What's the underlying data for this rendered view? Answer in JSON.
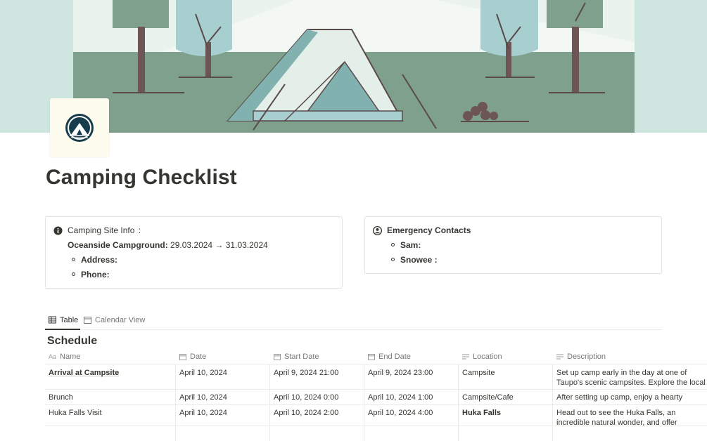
{
  "page": {
    "title": "Camping Checklist",
    "icon": "camping-tent-logo-icon",
    "cover": "tent-landscape-illustration"
  },
  "camping_site": {
    "heading": "Camping Site Info",
    "heading_suffix": ":",
    "icon": "info-icon",
    "site_name": "Oceanside Campground:",
    "dates": "29.03.2024 → 31.03.2024",
    "items": [
      {
        "label": "Address:"
      },
      {
        "label": "Phone:"
      }
    ]
  },
  "emergency": {
    "heading": "Emergency Contacts",
    "icon": "person-circle-icon",
    "items": [
      {
        "label": "Sam:"
      },
      {
        "label": "Snowee :"
      }
    ]
  },
  "views": {
    "tabs": [
      {
        "label": "Table",
        "icon": "table-icon",
        "active": true
      },
      {
        "label": "Calendar View",
        "icon": "calendar-icon",
        "active": false
      }
    ]
  },
  "schedule": {
    "title": "Schedule",
    "columns": [
      {
        "label": "Name",
        "icon": "text-property-icon"
      },
      {
        "label": "Date",
        "icon": "calendar-icon"
      },
      {
        "label": "Start Date",
        "icon": "calendar-icon"
      },
      {
        "label": "End Date",
        "icon": "calendar-icon"
      },
      {
        "label": "Location",
        "icon": "text-lines-icon"
      },
      {
        "label": "Description",
        "icon": "text-lines-icon"
      }
    ],
    "rows": [
      {
        "name": "Arrival at Campsite",
        "date": "April 10, 2024",
        "start": "April 9, 2024 21:00",
        "end": "April 9, 2024 23:00",
        "location": "Campsite",
        "description": "Set up camp early in the day at one of Taupo's scenic campsites. Explore the local rivers for the best experience."
      },
      {
        "name": "Brunch",
        "date": "April 10, 2024",
        "start": "April 10, 2024 0:00",
        "end": "April 10, 2024 1:00",
        "location": "Campsite/Cafe",
        "description": "After setting up camp, enjoy a hearty brunch to fuel the day."
      },
      {
        "name": "Huka Falls Visit",
        "date": "April 10, 2024",
        "start": "April 10, 2024 2:00",
        "end": "April 10, 2024 4:00",
        "location": "Huka Falls",
        "description": "Head out to see the Huka Falls, an incredible natural wonder, and offer stunning views and photo opportunities."
      }
    ]
  },
  "colors": {
    "text": "#37352f",
    "muted": "#787774",
    "border": "#e3e2df",
    "cover_sky": "#cfe6e0",
    "cover_ground": "#7fa08c",
    "tent": "#e4efe9",
    "tent_shade": "#82b2b0"
  }
}
